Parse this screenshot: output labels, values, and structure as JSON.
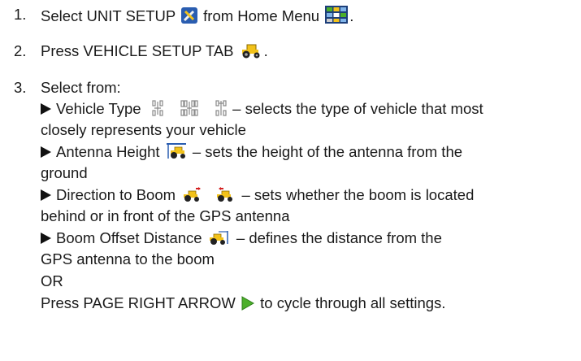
{
  "steps": [
    {
      "num": "1.",
      "pre": "Select UNIT SETUP",
      "mid": "from Home Menu",
      "post": "."
    },
    {
      "num": "2.",
      "pre": "Press VEHICLE SETUP TAB",
      "post": "."
    },
    {
      "num": "3.",
      "pre": "Select from:"
    }
  ],
  "options": [
    {
      "label": "Vehicle Type",
      "desc": "– selects the type of vehicle that most",
      "cont": "closely represents your vehicle"
    },
    {
      "label": "Antenna Height",
      "desc": "– sets the height of the antenna from the",
      "cont": "ground"
    },
    {
      "label": "Direction to Boom",
      "desc": "– sets whether the boom is located",
      "cont": "behind or in front of the GPS antenna"
    },
    {
      "label": "Boom Offset Distance",
      "desc": "– defines the distance from the",
      "cont": "GPS antenna to the boom"
    }
  ],
  "or_text": "OR",
  "final": {
    "pre": "Press PAGE RIGHT ARROW",
    "post": "to cycle through all settings."
  },
  "colors": {
    "icon_blue": "#2a5db0",
    "icon_yellow": "#f2c21a",
    "arrow_green": "#4caf2a"
  }
}
